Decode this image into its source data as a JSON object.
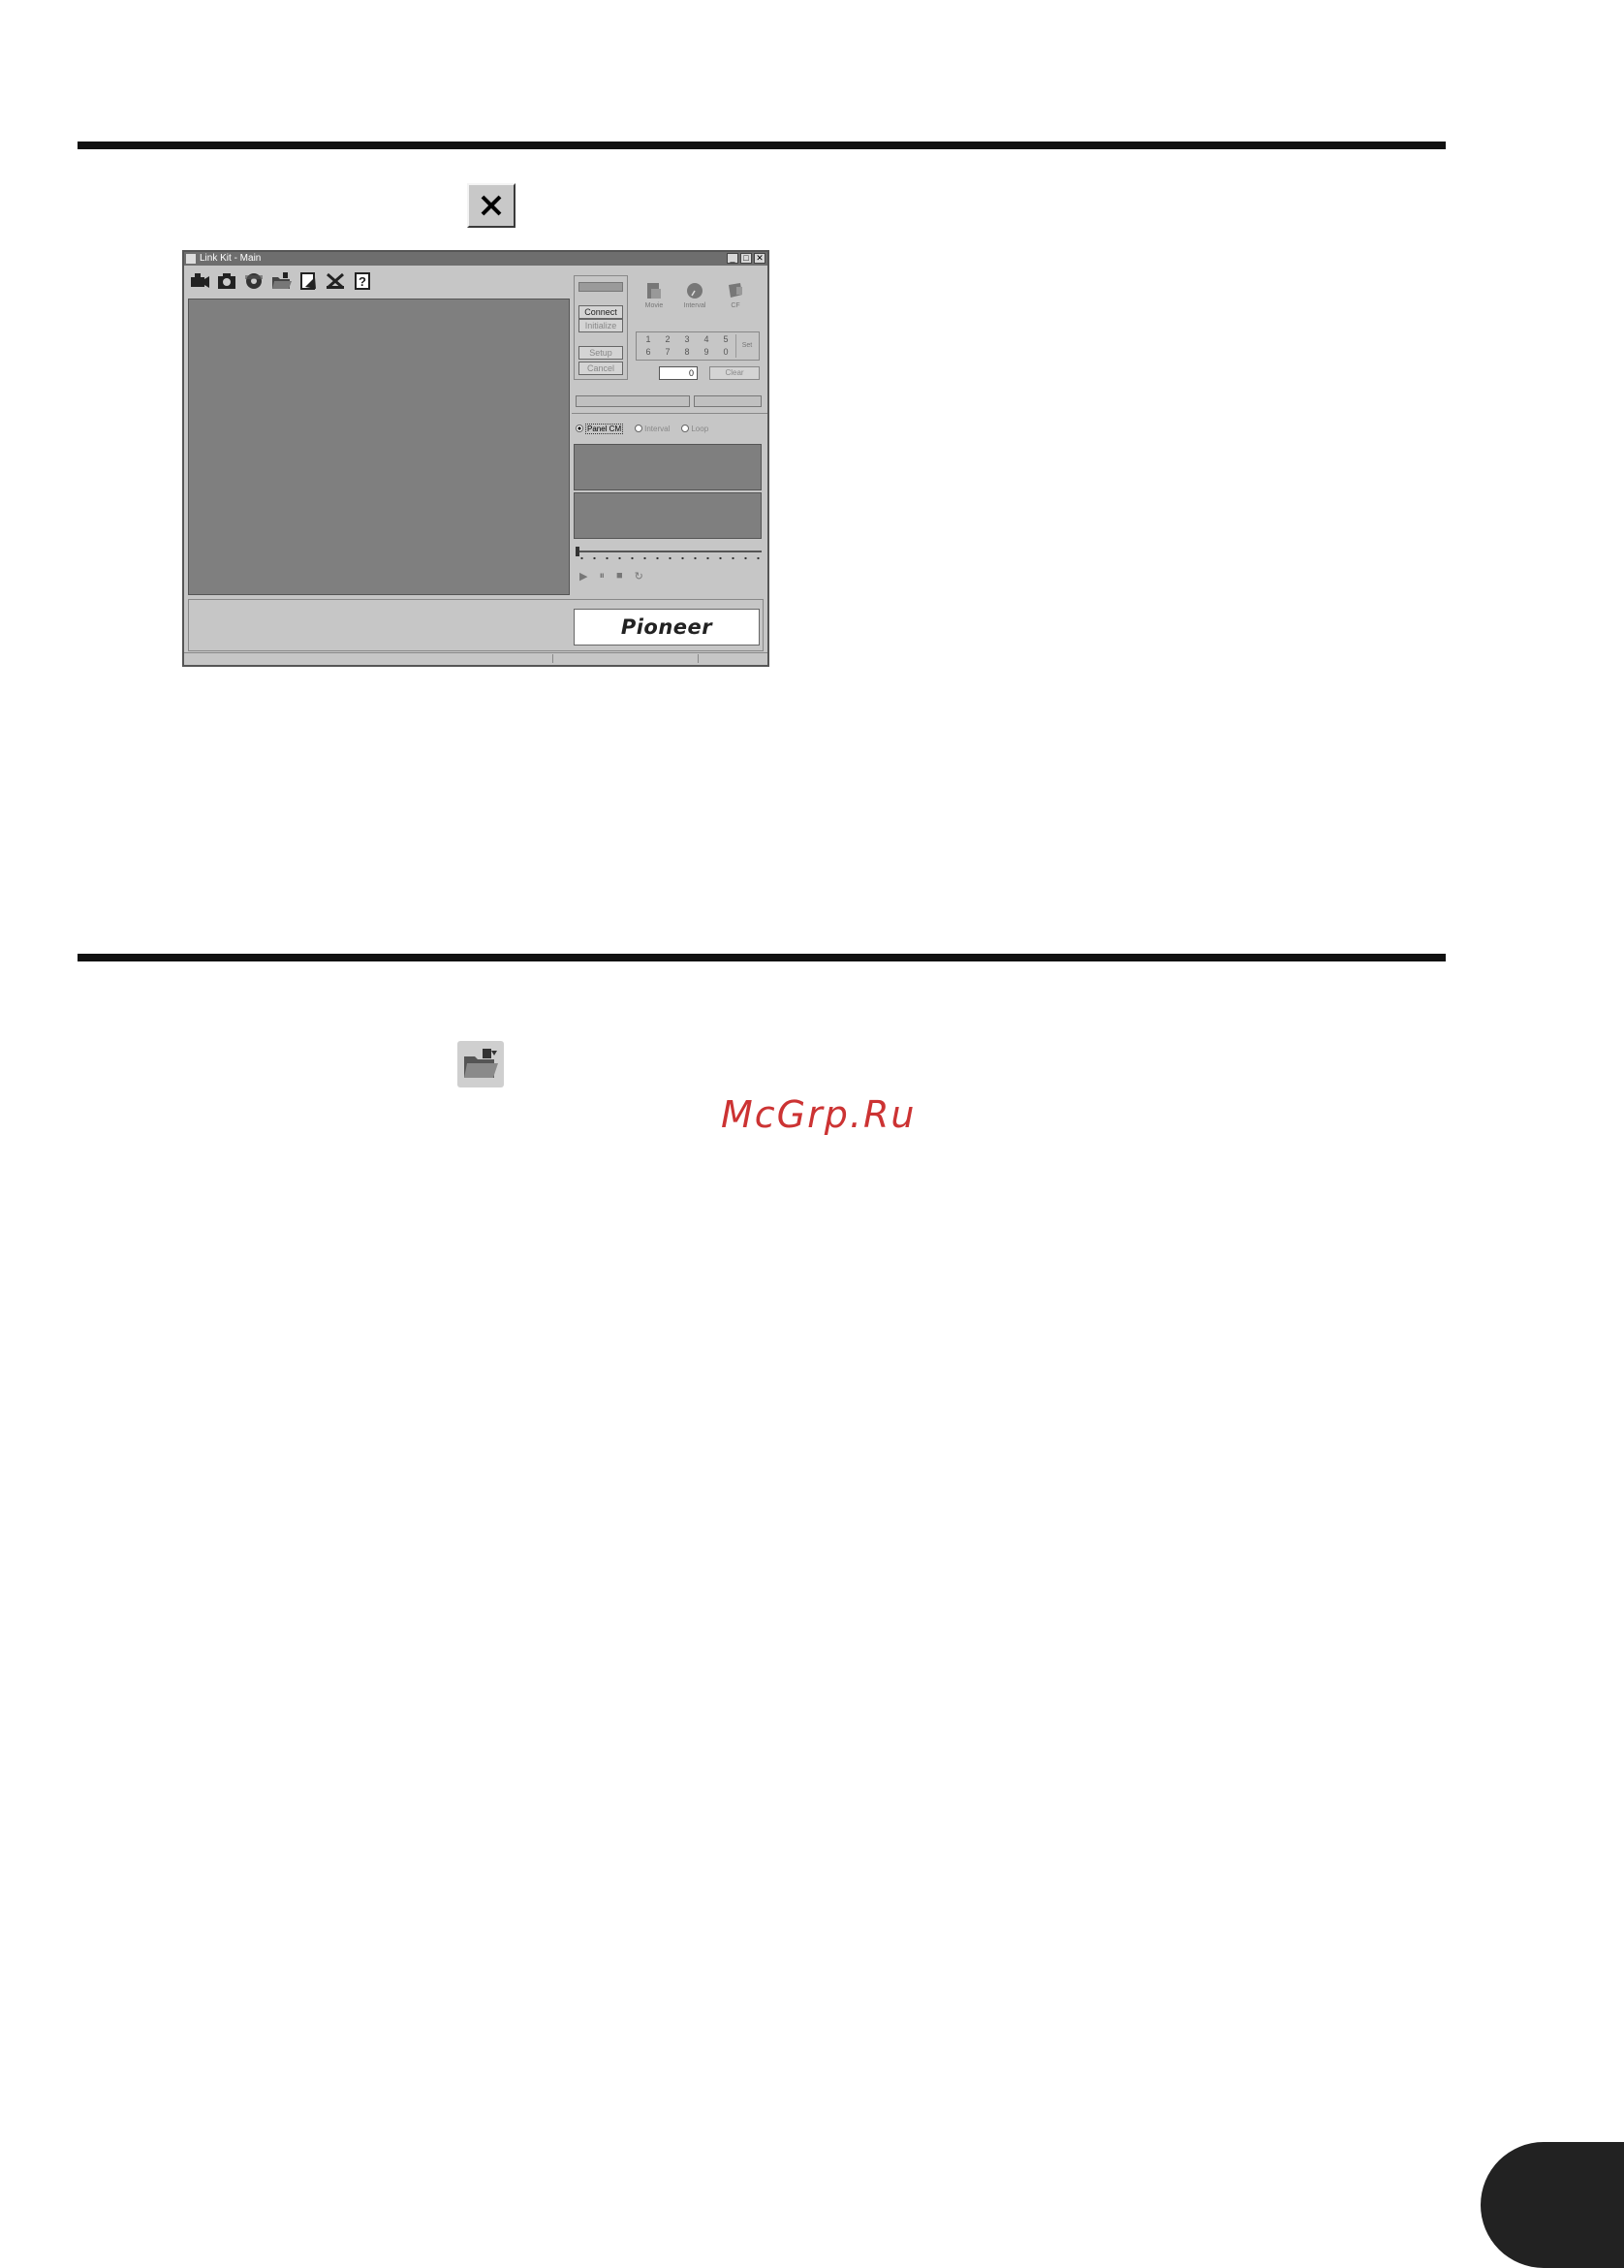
{
  "window": {
    "title": "Link Kit - Main",
    "controls": {
      "minimize": "_",
      "maximize": "□",
      "close": "✕"
    }
  },
  "toolbar": {
    "icons": [
      "camera-icon",
      "capture-icon",
      "disc-icon",
      "open-folder-icon",
      "page-icon",
      "tools-icon",
      "help-icon"
    ],
    "help_label": "?"
  },
  "device_panel": {
    "connect_label": "Connect",
    "initialize_label": "Initialize",
    "setup_label": "Setup",
    "cancel_label": "Cancel",
    "mode_labels": [
      "Movie",
      "Interval",
      "CF"
    ],
    "keypad": [
      "1",
      "2",
      "3",
      "4",
      "5",
      "6",
      "7",
      "8",
      "9",
      "0"
    ],
    "keypad_extra": "Set",
    "number_value": "0",
    "clear_label": "Clear"
  },
  "view_modes": {
    "options": [
      "Panel CM",
      "Interval",
      "Loop"
    ],
    "selected": "Panel CM"
  },
  "transport": {
    "play": "▶",
    "pause": "⏸",
    "stop": "■",
    "loop": "↻"
  },
  "brand": {
    "logo_text": "Pioneer"
  },
  "watermark": {
    "text": "McGrp.Ru"
  }
}
